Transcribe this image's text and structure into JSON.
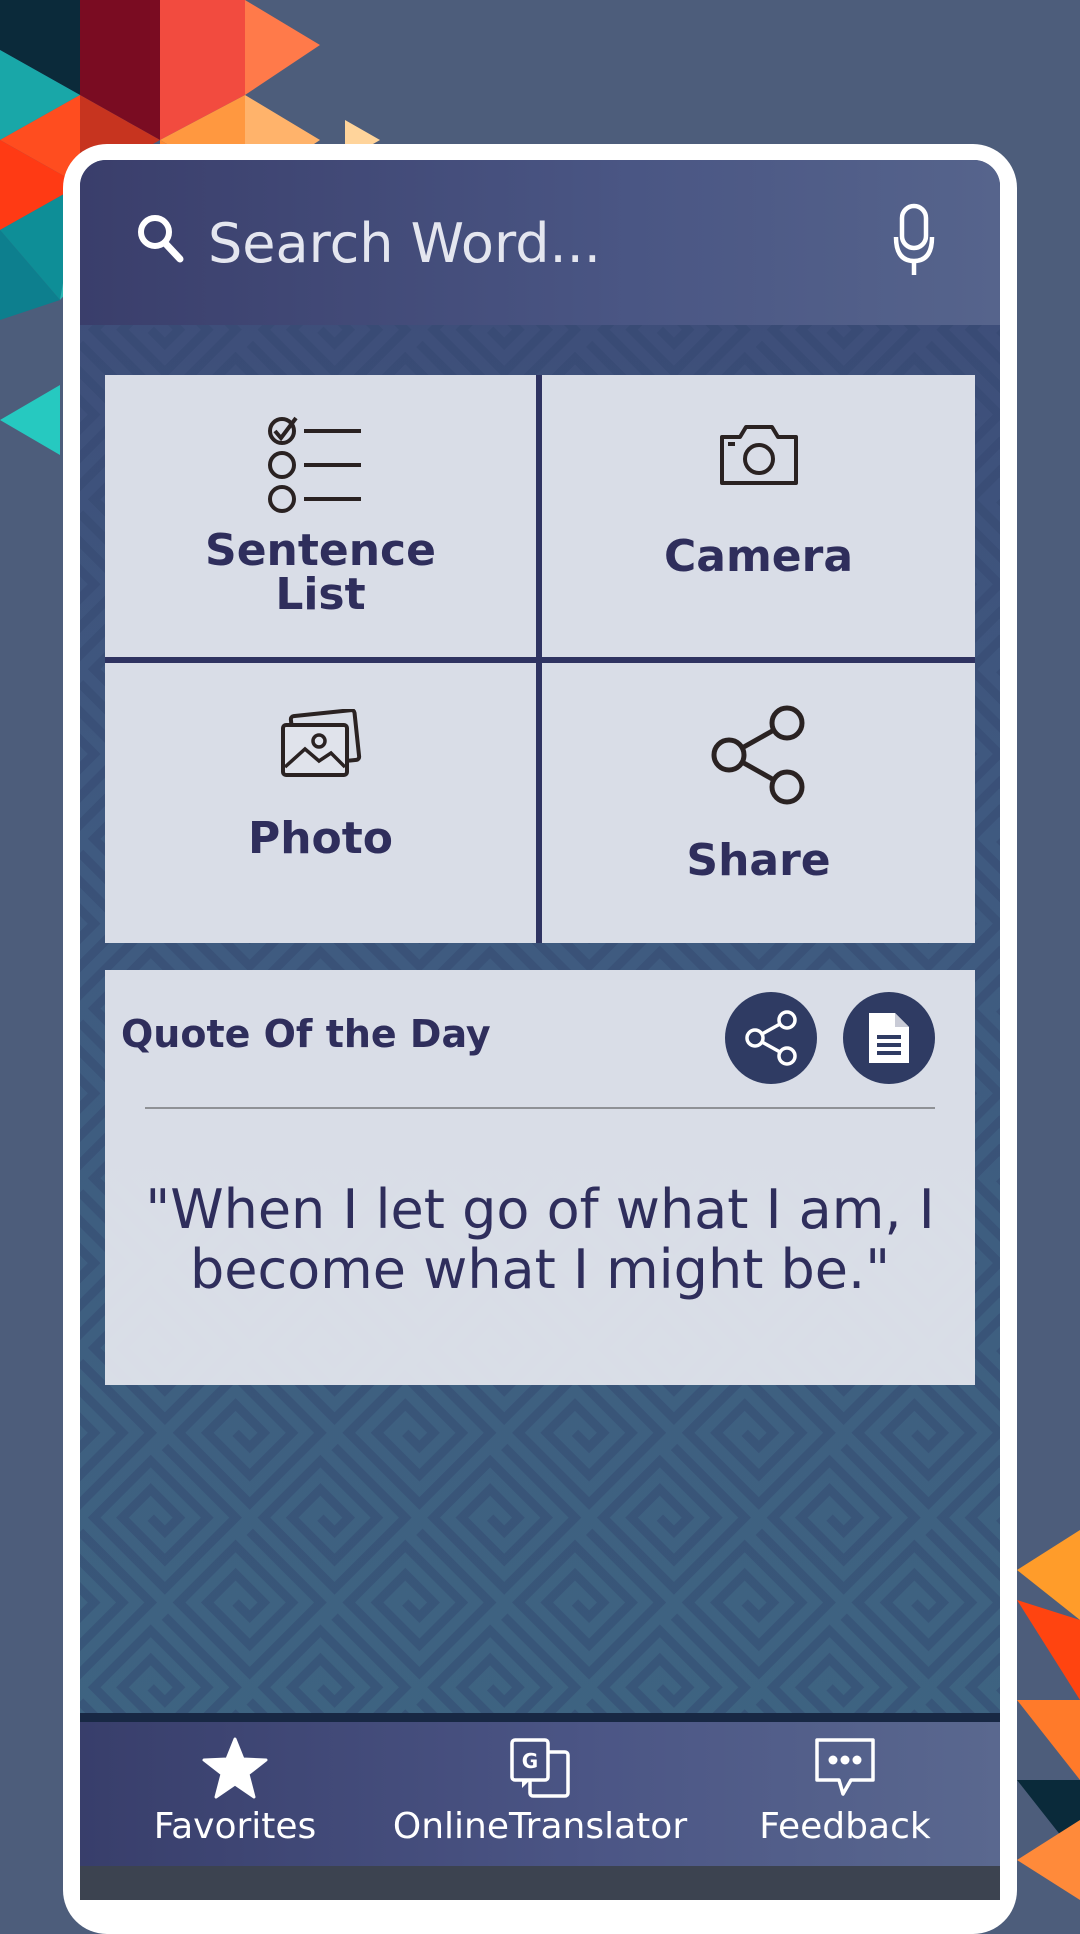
{
  "search": {
    "placeholder": "Search Word..."
  },
  "grid": {
    "sentence_list_label_line1": "Sentence",
    "sentence_list_label_line2": "List",
    "camera_label": "Camera",
    "photo_label": "Photo",
    "share_label": "Share"
  },
  "quote": {
    "title": "Quote Of the Day",
    "text": "\"When I let go of what I am, I become what I might be.\""
  },
  "bottom_nav": {
    "favorites": "Favorites",
    "translator": "OnlineTranslator",
    "feedback": "Feedback"
  },
  "icons": {
    "search": "search-icon",
    "mic": "microphone-icon",
    "checklist": "checklist-icon",
    "camera": "camera-icon",
    "photo": "photo-icon",
    "share": "share-icon",
    "document": "document-icon",
    "star": "star-icon",
    "translate": "translate-icon",
    "feedback": "chat-bubble-icon"
  },
  "colors": {
    "background": "#4d5d7b",
    "header": "#3a3e6b",
    "tile": "#e0e3eb",
    "label": "#2f2e5c",
    "round_button": "#2f3b63"
  }
}
